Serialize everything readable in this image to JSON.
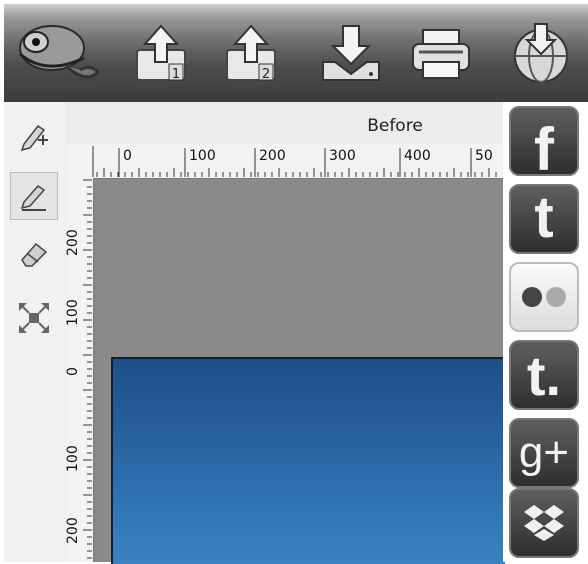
{
  "toolbar": {
    "buttons": [
      {
        "name": "chameleon-logo",
        "icon": "chameleon-icon"
      },
      {
        "name": "upload-1-button",
        "icon": "upload-icon",
        "badge": "1"
      },
      {
        "name": "upload-2-button",
        "icon": "upload-icon",
        "badge": "2"
      },
      {
        "name": "download-button",
        "icon": "download-icon"
      },
      {
        "name": "print-button",
        "icon": "printer-icon"
      },
      {
        "name": "web-save-button",
        "icon": "globe-download-icon"
      }
    ]
  },
  "tools": [
    "pencil-add-icon",
    "pencil-edit-icon",
    "eraser-icon",
    "fit-screen-icon"
  ],
  "view": {
    "title": "Before",
    "hruler_labels": [
      "0",
      "100",
      "200",
      "300",
      "400",
      "50"
    ],
    "vruler_labels": [
      "200",
      "100",
      "0",
      "100",
      "200"
    ]
  },
  "social": [
    {
      "name": "facebook-button",
      "icon": "facebook-icon",
      "text": "f"
    },
    {
      "name": "twitter-button",
      "icon": "twitter-icon",
      "text": "t"
    },
    {
      "name": "flickr-button",
      "icon": "flickr-icon",
      "text": ""
    },
    {
      "name": "tumblr-button",
      "icon": "tumblr-icon",
      "text": "t."
    },
    {
      "name": "googleplus-button",
      "icon": "google-plus-icon",
      "text": "g+"
    },
    {
      "name": "dropbox-button",
      "icon": "dropbox-icon",
      "text": ""
    }
  ],
  "colors": {
    "toolbar_dark": "#3c3c3c",
    "canvas": "#8a8a8a",
    "photo_blue": "#26609d"
  }
}
